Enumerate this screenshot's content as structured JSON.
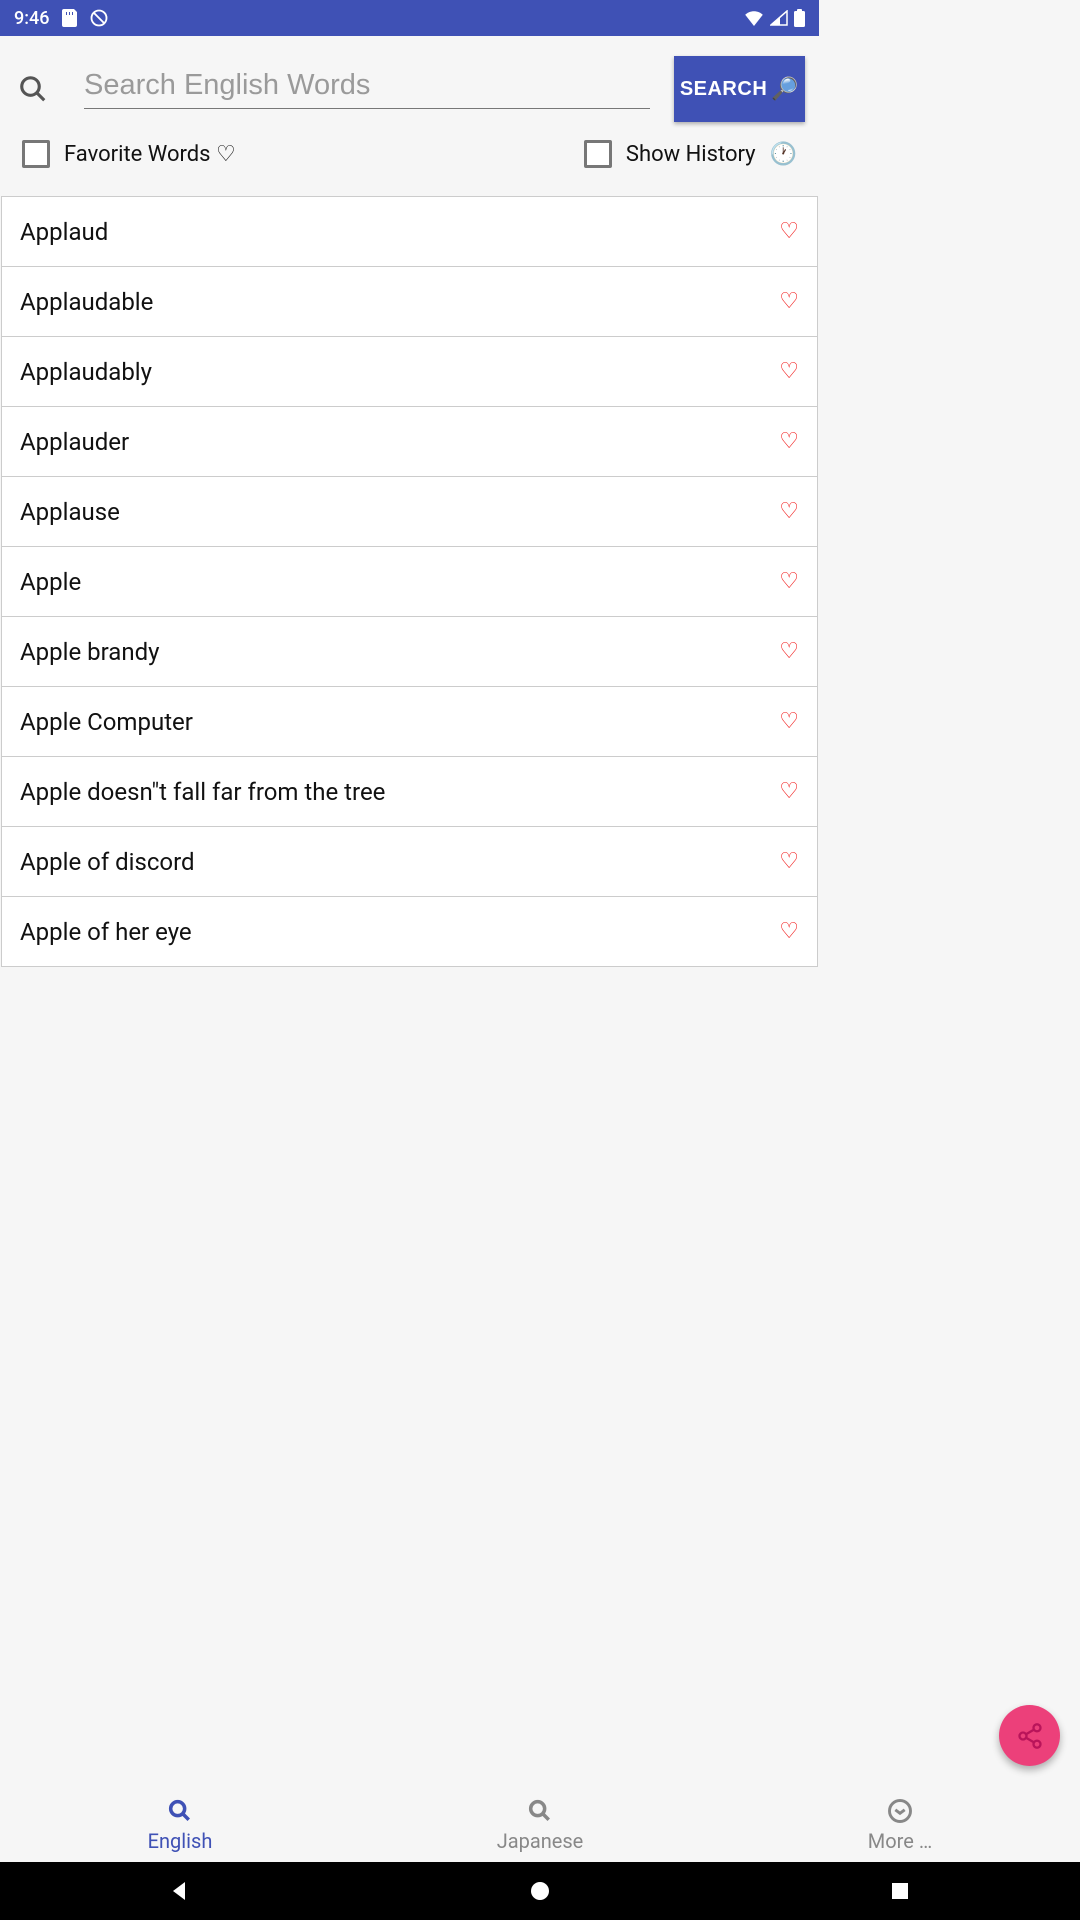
{
  "status": {
    "time": "9:46"
  },
  "search": {
    "placeholder": "Search English Words",
    "button": "SEARCH"
  },
  "filters": {
    "favorite": "Favorite Words ♡",
    "history": "Show History"
  },
  "words": [
    "Applaud",
    "Applaudable",
    "Applaudably",
    "Applauder",
    "Applause",
    "Apple",
    "Apple brandy",
    "Apple Computer",
    "Apple doesn\"t fall far from the tree",
    "Apple of discord",
    "Apple of her eye"
  ],
  "tabs": {
    "english": "English",
    "japanese": "Japanese",
    "more": "More …"
  }
}
